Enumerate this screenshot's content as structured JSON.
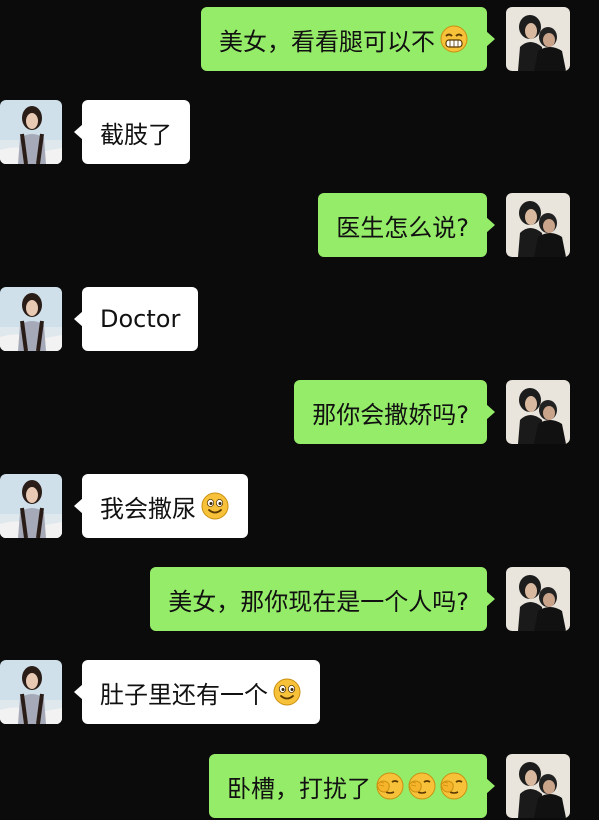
{
  "messages": [
    {
      "side": "out",
      "text": "美女，看看腿可以不",
      "emoji": [
        "grin-emoji"
      ]
    },
    {
      "side": "in",
      "text": "截肢了",
      "emoji": []
    },
    {
      "side": "out",
      "text": "医生怎么说?",
      "emoji": []
    },
    {
      "side": "in",
      "text": "Doctor",
      "emoji": []
    },
    {
      "side": "out",
      "text": "那你会撒娇吗?",
      "emoji": []
    },
    {
      "side": "in",
      "text": "我会撒尿",
      "emoji": [
        "smile-emoji"
      ]
    },
    {
      "side": "out",
      "text": "美女，那你现在是一个人吗?",
      "emoji": []
    },
    {
      "side": "in",
      "text": "肚子里还有一个",
      "emoji": [
        "smile-emoji"
      ]
    },
    {
      "side": "out",
      "text": "卧槽，打扰了",
      "emoji": [
        "facepalm-emoji",
        "facepalm-emoji",
        "facepalm-emoji"
      ]
    }
  ],
  "colors": {
    "background": "#0b0b0b",
    "outgoing_bubble": "#95ec69",
    "incoming_bubble": "#ffffff"
  },
  "avatars": {
    "self": "couple-photo-avatar",
    "contact": "woman-boat-photo-avatar"
  }
}
